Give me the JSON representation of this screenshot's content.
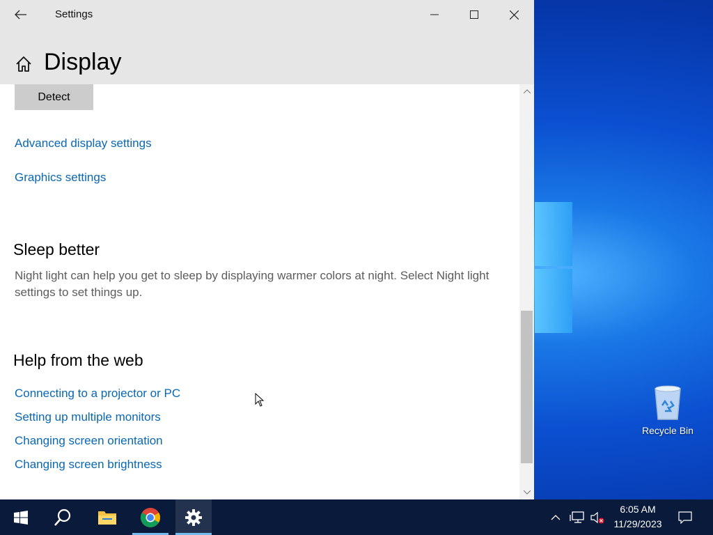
{
  "window": {
    "title": "Settings",
    "page_title": "Display"
  },
  "content": {
    "detect_label": "Detect",
    "links_top": [
      "Advanced display settings",
      "Graphics settings"
    ],
    "sleep_title": "Sleep better",
    "sleep_text": "Night light can help you get to sleep by displaying warmer colors at night. Select Night light settings to set things up.",
    "help_title": "Help from the web",
    "help_links": [
      "Connecting to a projector or PC",
      "Setting up multiple monitors",
      "Changing screen orientation",
      "Changing screen brightness"
    ]
  },
  "desktop": {
    "recycle_bin_label": "Recycle Bin"
  },
  "taskbar": {
    "items": [
      "start-icon",
      "search-icon",
      "file-explorer-icon",
      "chrome-icon",
      "settings-icon"
    ],
    "time": "6:05 AM",
    "date": "11/29/2023"
  },
  "colors": {
    "link": "#0a67b4",
    "titlebar": "#e6e6e6",
    "taskbar": "#0a1a3a",
    "desktop": "#0b4fd0"
  }
}
